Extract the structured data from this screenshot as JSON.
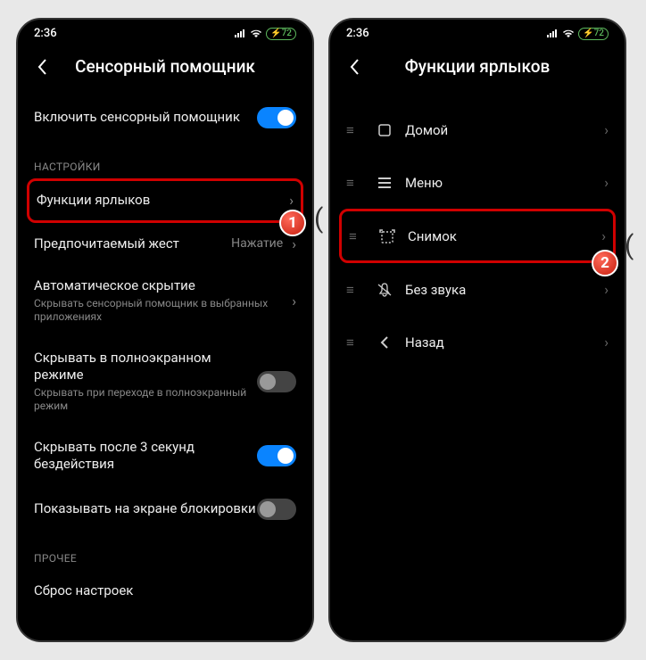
{
  "statusBar": {
    "time": "2:36",
    "battery": "72"
  },
  "left": {
    "title": "Сенсорный помощник",
    "enable": {
      "label": "Включить сенсорный помощник",
      "on": true
    },
    "sectionSettings": "НАСТРОЙКИ",
    "shortcuts": {
      "label": "Функции ярлыков"
    },
    "gesture": {
      "label": "Предпочитаемый жест",
      "value": "Нажатие"
    },
    "autohide": {
      "label": "Автоматическое скрытие",
      "sub": "Скрывать сенсорный помощник в выбранных приложениях"
    },
    "fullscreen": {
      "label": "Скрывать в полноэкранном режиме",
      "sub": "Скрывать при переходе в полноэкранный режим",
      "on": false
    },
    "hide3s": {
      "label": "Скрывать после 3 секунд бездействия",
      "on": true
    },
    "lockscreen": {
      "label": "Показывать на экране блокировки",
      "on": false
    },
    "sectionOther": "ПРОЧЕЕ",
    "reset": {
      "label": "Сброс настроек"
    }
  },
  "right": {
    "title": "Функции ярлыков",
    "items": [
      {
        "label": "Домой",
        "icon": "home"
      },
      {
        "label": "Меню",
        "icon": "menu"
      },
      {
        "label": "Снимок",
        "icon": "screenshot",
        "highlight": true
      },
      {
        "label": "Без звука",
        "icon": "mute"
      },
      {
        "label": "Назад",
        "icon": "back"
      }
    ]
  },
  "badges": {
    "one": "1",
    "two": "2"
  }
}
